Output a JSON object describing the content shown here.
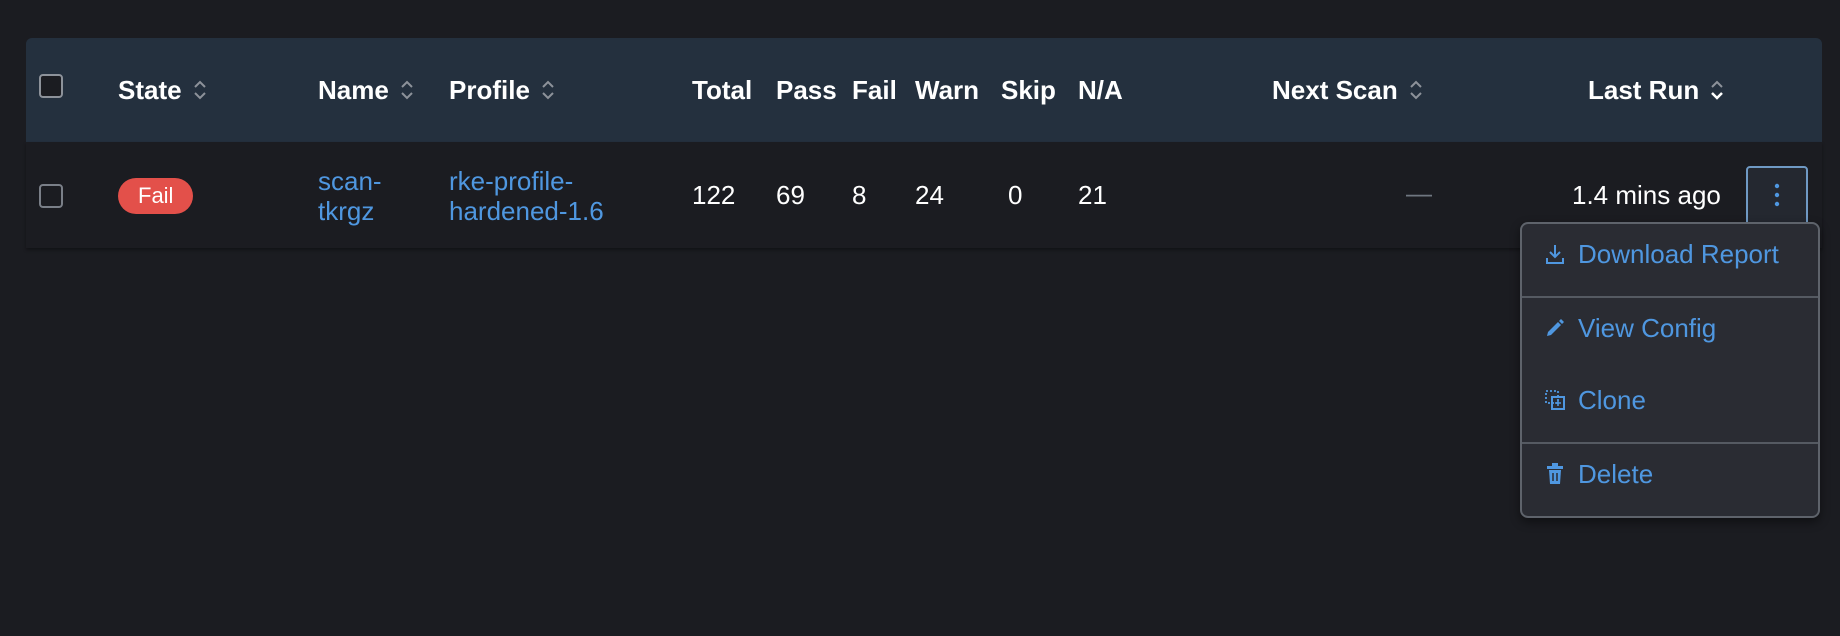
{
  "table": {
    "columns": {
      "state": "State",
      "name": "Name",
      "profile": "Profile",
      "total": "Total",
      "pass": "Pass",
      "fail": "Fail",
      "warn": "Warn",
      "skip": "Skip",
      "na": "N/A",
      "next_scan": "Next Scan",
      "last_run": "Last Run"
    },
    "rows": [
      {
        "state": "Fail",
        "name": "scan-\ntkrgz",
        "profile": "rke-profile-\nhardened-1.6",
        "total": "122",
        "pass": "69",
        "fail": "8",
        "warn": "24",
        "skip": "0",
        "na": "21",
        "next_scan": "—",
        "last_run": "1.4 mins ago"
      }
    ]
  },
  "actions_menu": {
    "items": [
      {
        "label": "Download Report",
        "icon": "download-icon"
      },
      {
        "label": "View Config",
        "icon": "pencil-icon"
      },
      {
        "label": "Clone",
        "icon": "clone-icon"
      },
      {
        "label": "Delete",
        "icon": "trash-icon"
      }
    ]
  },
  "colors": {
    "background": "#1b1c21",
    "header": "#24303e",
    "link": "#4f97e0",
    "fail_badge": "#e3504a"
  }
}
